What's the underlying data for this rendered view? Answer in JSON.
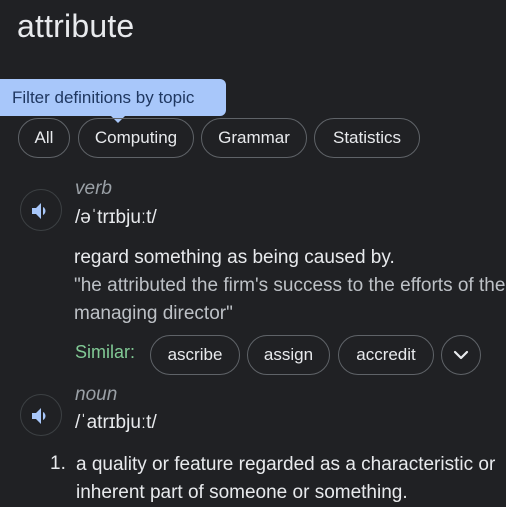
{
  "headword": "attribute",
  "tooltip": "Filter definitions by topic",
  "topics": [
    "All",
    "Computing",
    "Grammar",
    "Statistics"
  ],
  "entries": [
    {
      "pos": "verb",
      "pronunciation": "/əˈtrɪbjuːt/",
      "definition": "regard something as being caused by.",
      "example": "\"he attributed the firm's success to the efforts of the managing director\"",
      "similar_label": "Similar:",
      "synonyms": [
        "ascribe",
        "assign",
        "accredit"
      ]
    },
    {
      "pos": "noun",
      "pronunciation": "/ˈatrɪbjuːt/",
      "sense_number": "1.",
      "definition": "a quality or feature regarded as a characteristic or inherent part of someone or something."
    }
  ],
  "icons": {
    "speaker": "volume-icon",
    "expand": "chevron-down-icon"
  },
  "colors": {
    "background": "#202124",
    "tooltip": "#a8c7fa",
    "similar_label": "#81c995",
    "speaker_icon": "#a8c7fa"
  }
}
